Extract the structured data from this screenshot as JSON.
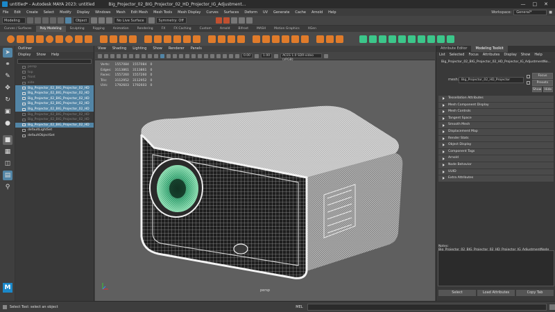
{
  "titlebar": {
    "app_title": "untitled* - Autodesk MAYA 2023: untitled",
    "node_title": "Big_Projector_02_BIG_Projector_02_HD_Projector_IG_Adjustment..."
  },
  "menubar": {
    "items": [
      "File",
      "Edit",
      "Create",
      "Select",
      "Modify",
      "Display",
      "Windows",
      "Mesh",
      "Edit Mesh",
      "Mesh Tools",
      "Mesh Display",
      "Curves",
      "Surfaces",
      "Deform",
      "UV",
      "Generate",
      "Cache",
      "Arnold",
      "Help"
    ],
    "workspace_label": "Workspace:",
    "workspace_value": "General*"
  },
  "statusline": {
    "mode": "Modeling",
    "object_field": "Object",
    "live_surface": "No Live Surface",
    "symmetry": "Symmetry: Off"
  },
  "shelf_tabs": [
    "Curves / Surfaces",
    "Poly Modeling",
    "Sculpting",
    "Rigging",
    "Animation",
    "Rendering",
    "FX",
    "FX Caching",
    "Custom",
    "Arnold",
    "Bifrost",
    "MASH",
    "Motion Graphics",
    "XGen"
  ],
  "shelf_active_tab": "Poly Modeling",
  "outliner": {
    "title": "Outliner",
    "menu": [
      "Display",
      "Show",
      "Help"
    ],
    "items": [
      {
        "label": "persp",
        "state": "hidden"
      },
      {
        "label": "top",
        "state": "hidden"
      },
      {
        "label": "front",
        "state": "hidden"
      },
      {
        "label": "side",
        "state": "hidden"
      },
      {
        "label": "Big_Projector_02_BIG_Projector_02_HD",
        "state": "selected"
      },
      {
        "label": "Big_Projector_02_BIG_Projector_02_HD",
        "state": "selected"
      },
      {
        "label": "Big_Projector_02_BIG_Projector_02_HD",
        "state": "selected"
      },
      {
        "label": "Big_Projector_02_BIG_Projector_02_HD",
        "state": "selected"
      },
      {
        "label": "Big_Projector_02_BIG_Projector_02_HD",
        "state": "selected"
      },
      {
        "label": "Big_Projector_02_BIG_Projector_02_HD",
        "state": "hidden"
      },
      {
        "label": "Big_Projector_02_BIG_Projector_02_HD",
        "state": "hidden"
      },
      {
        "label": "Big_Projector_02_BIG_Projector_02_HD",
        "state": "selected"
      },
      {
        "label": "defaultLightSet",
        "state": "normal"
      },
      {
        "label": "defaultObjectSet",
        "state": "normal"
      }
    ]
  },
  "viewport": {
    "menu": [
      "View",
      "Shading",
      "Lighting",
      "Show",
      "Renderer",
      "Panels"
    ],
    "exposure": "0.00",
    "gamma": "1.00",
    "color_space": "ACES 1.0 SDR-video (sRGB)",
    "camera_label": "persp",
    "hud": [
      {
        "label": "Verts:",
        "a": "1557084",
        "b": "1557084",
        "c": "0"
      },
      {
        "label": "Edges:",
        "a": "3113861",
        "b": "3113861",
        "c": "0"
      },
      {
        "label": "Faces:",
        "a": "1557260",
        "b": "1557260",
        "c": "0"
      },
      {
        "label": "Tris:",
        "a": "3112952",
        "b": "3112952",
        "c": "0"
      },
      {
        "label": "UVs:",
        "a": "1792603",
        "b": "1792603",
        "c": "0"
      }
    ]
  },
  "attribute_editor": {
    "tabs": [
      "Attribute Editor",
      "Modeling Toolkit"
    ],
    "active_tab": "Modeling Toolkit",
    "menu": [
      "List",
      "Selected",
      "Focus",
      "Attributes",
      "Display",
      "Show",
      "Help"
    ],
    "node_name": "Big_Projector_02_BIG_Projector_02_HD_Projector_IG_AdjustmentNo...",
    "mesh_label": "mesh:",
    "mesh_value": "Big_Projector_02_HD_Projector",
    "buttons": {
      "focus": "Focus",
      "presets": "Presets",
      "show": "Show",
      "hide": "Hide"
    },
    "sections": [
      "Tessellation Attributes",
      "Mesh Component Display",
      "Mesh Controls",
      "Tangent Space",
      "Smooth Mesh",
      "Displacement Map",
      "Render Stats",
      "Object Display",
      "Component Tags",
      "Arnold",
      "Node Behavior",
      "UUID",
      "Extra Attributes"
    ],
    "notes_label": "Notes: Big_Projector_02_BIG_Projector_02_HD_Projector_IG_AdjustmentNode",
    "bottom_buttons": [
      "Select",
      "Load Attributes",
      "Copy Tab"
    ]
  },
  "helpline": {
    "message": "Select Tool: select an object",
    "mel_label": "MEL"
  },
  "colors": {
    "accent_orange": "#e07b2a",
    "select_blue": "#5285a6",
    "shelf_green": "#3cc68a",
    "lens_green": "#2fa46e"
  }
}
